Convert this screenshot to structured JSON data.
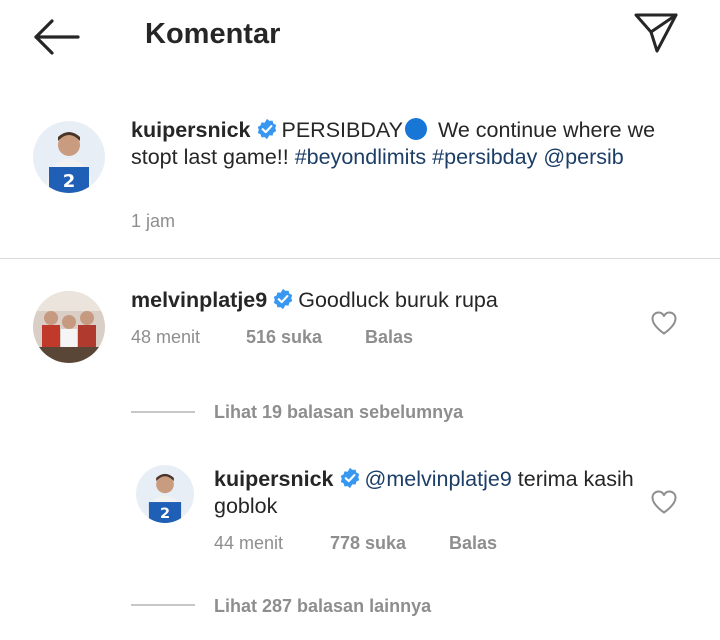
{
  "header": {
    "title": "Komentar",
    "back_icon": "arrow-left-icon",
    "send_icon": "paper-plane-icon"
  },
  "caption": {
    "username": "kuipersnick",
    "text_part1": "PERSIBDAY",
    "text_part2": " We continue where we stopt last game!! ",
    "tag1": "#beyondlimits",
    "tag2": "#persibday",
    "mention": "@persib",
    "time": "1 jam"
  },
  "comment": {
    "username": "melvinplatje9",
    "text": "Goodluck buruk rupa",
    "time": "48 menit",
    "likes": "516 suka",
    "reply": "Balas"
  },
  "view_previous": "Lihat 19 balasan sebelumnya",
  "reply": {
    "username": "kuipersnick",
    "mention": "@melvinplatje9",
    "text": " terima kasih goblok",
    "time": "44 menit",
    "likes": "778 suka",
    "reply": "Balas"
  },
  "view_more": "Lihat 287 balasan lainnya",
  "colors": {
    "verified": "#3897f0",
    "link": "#1c3e67",
    "muted": "#8e8e8e",
    "persib_dot": "#1877d6"
  }
}
